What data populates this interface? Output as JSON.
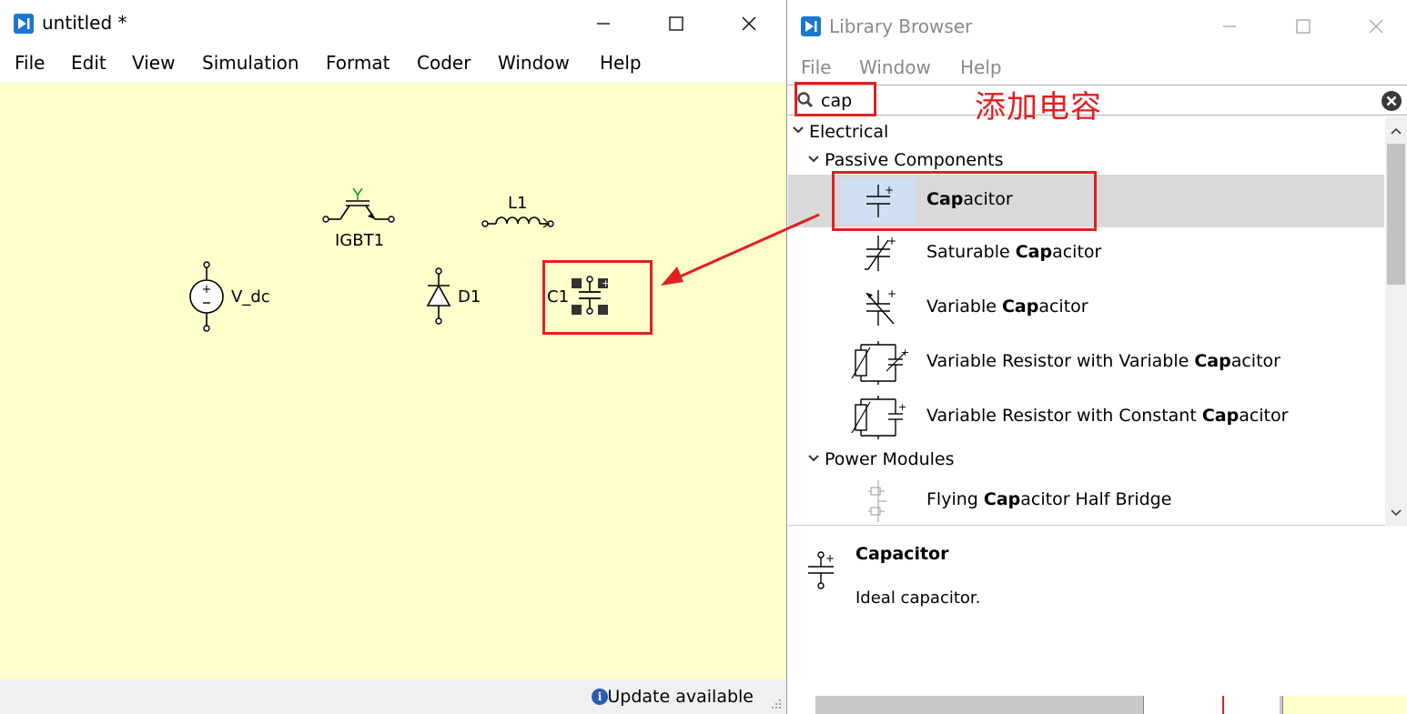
{
  "editor": {
    "title": "untitled *",
    "menu": [
      "File",
      "Edit",
      "View",
      "Simulation",
      "Format",
      "Coder",
      "Window",
      "Help"
    ],
    "components": {
      "igbt": "IGBT1",
      "inductor": "L1",
      "voltage_source": "V_dc",
      "diode": "D1",
      "capacitor": "C1"
    },
    "status": "Update available"
  },
  "library": {
    "title": "Library Browser",
    "menu": [
      "File",
      "Window",
      "Help"
    ],
    "search": {
      "value": "cap"
    },
    "annotation": "添加电容",
    "tree": {
      "electrical": "Electrical",
      "passive": "Passive Components",
      "power_modules": "Power Modules",
      "items": [
        {
          "pre": "",
          "bold": "Cap",
          "post": "acitor",
          "selected": true
        },
        {
          "pre": "Saturable ",
          "bold": "Cap",
          "post": "acitor",
          "selected": false
        },
        {
          "pre": "Variable ",
          "bold": "Cap",
          "post": "acitor",
          "selected": false
        },
        {
          "pre": "Variable Resistor with Variable ",
          "bold": "Cap",
          "post": "acitor",
          "selected": false
        },
        {
          "pre": "Variable Resistor with Constant ",
          "bold": "Cap",
          "post": "acitor",
          "selected": false
        }
      ],
      "power_items": [
        {
          "pre": "Flying ",
          "bold": "Cap",
          "post": "acitor Half Bridge"
        }
      ]
    },
    "details": {
      "title": "Capacitor",
      "description": "Ideal capacitor."
    }
  },
  "colors": {
    "canvas": "#ffffcc",
    "highlight": "#e02020",
    "accent": "#1976d2"
  }
}
